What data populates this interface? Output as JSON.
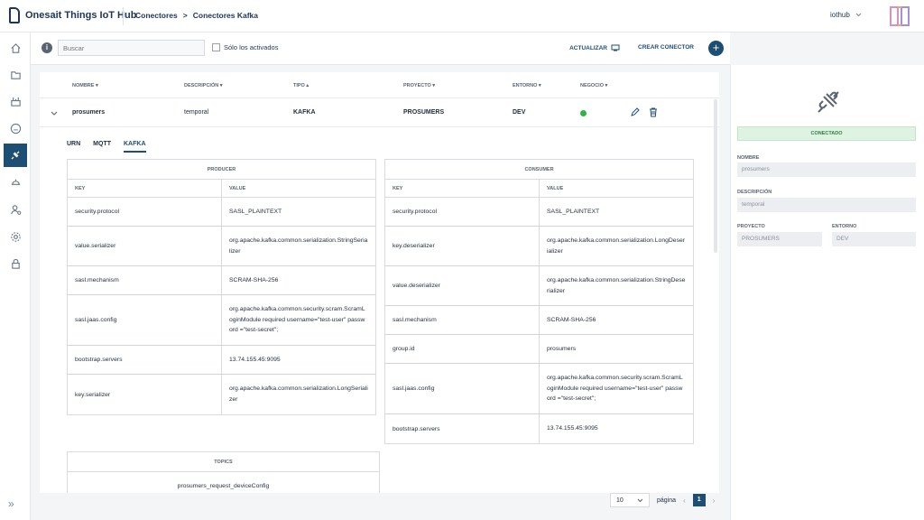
{
  "header": {
    "app_title": "Onesait Things IoT Hub",
    "breadcrumb": [
      "Conectores",
      ">",
      "Conectores Kafka"
    ],
    "user": "iothub"
  },
  "toolbar": {
    "search_placeholder": "Buscar",
    "only_active_label": "Sólo los activados",
    "refresh_label": "ACTUALIZAR",
    "create_label": "CREAR CONECTOR"
  },
  "table": {
    "columns": [
      "NOMBRE",
      "DESCRIPCIÓN",
      "TIPO",
      "PROYECTO",
      "ENTORNO",
      "NEGOCIO"
    ],
    "row": {
      "name": "prosumers",
      "description": "temporal",
      "type": "KAFKA",
      "project": "PROSUMERS",
      "environment": "DEV",
      "status_color": "#2fb344"
    }
  },
  "tabs": [
    "URN",
    "MQTT",
    "KAFKA"
  ],
  "producer": {
    "title": "PRODUCER",
    "key_header": "KEY",
    "value_header": "VALUE",
    "rows": [
      {
        "key": "security.protocol",
        "value": "SASL_PLAINTEXT"
      },
      {
        "key": "value.serializer",
        "value": "org.apache.kafka.common.serialization.StringSerializer"
      },
      {
        "key": "sasl.mechanism",
        "value": "SCRAM-SHA-256"
      },
      {
        "key": "sasl.jaas.config",
        "value": "org.apache.kafka.common.security.scram.ScramLoginModule required username=\"test-user\" password =\"test-secret\";"
      },
      {
        "key": "bootstrap.servers",
        "value": "13.74.155.45:9095"
      },
      {
        "key": "key.serializer",
        "value": "org.apache.kafka.common.serialization.LongSerializer"
      }
    ]
  },
  "consumer": {
    "title": "CONSUMER",
    "key_header": "KEY",
    "value_header": "VALUE",
    "rows": [
      {
        "key": "security.protocol",
        "value": "SASL_PLAINTEXT"
      },
      {
        "key": "key.deserializer",
        "value": "org.apache.kafka.common.serialization.LongDeserializer"
      },
      {
        "key": "value.deserializer",
        "value": "org.apache.kafka.common.serialization.StringDeserializer"
      },
      {
        "key": "sasl.mechanism",
        "value": "SCRAM-SHA-256"
      },
      {
        "key": "group.id",
        "value": "prosumers"
      },
      {
        "key": "sasl.jaas.config",
        "value": "org.apache.kafka.common.security.scram.ScramLoginModule required username=\"test-user\" password =\"test-secret\";"
      },
      {
        "key": "bootstrap.servers",
        "value": "13.74.155.45:9095"
      }
    ]
  },
  "topics": {
    "title": "TOPICS",
    "value": "prosumers_request_deviceConfig"
  },
  "pagination": {
    "page_size": "10",
    "label": "página",
    "current_page": "1"
  },
  "detail": {
    "status": "CONECTADO",
    "name_label": "NOMBRE",
    "name_value": "prosumers",
    "description_label": "DESCRIPCIÓN",
    "description_value": "temporal",
    "project_label": "PROYECTO",
    "project_value": "PROSUMERS",
    "environment_label": "ENTORNO",
    "environment_value": "DEV"
  },
  "colors": {
    "primary": "#1d4e73",
    "connected_bg": "#dff3e3",
    "connected_text": "#2f7d41"
  },
  "icons": [
    "home-icon",
    "folder-icon",
    "devices-icon",
    "crm-icon",
    "plug-icon",
    "dish-icon",
    "user-gear-icon",
    "gear-icon",
    "lock-icon",
    "collapse-icon",
    "info-icon",
    "refresh-icon",
    "plus-icon",
    "chevron-down-icon",
    "edit-icon",
    "trash-icon",
    "plug-large-icon"
  ]
}
